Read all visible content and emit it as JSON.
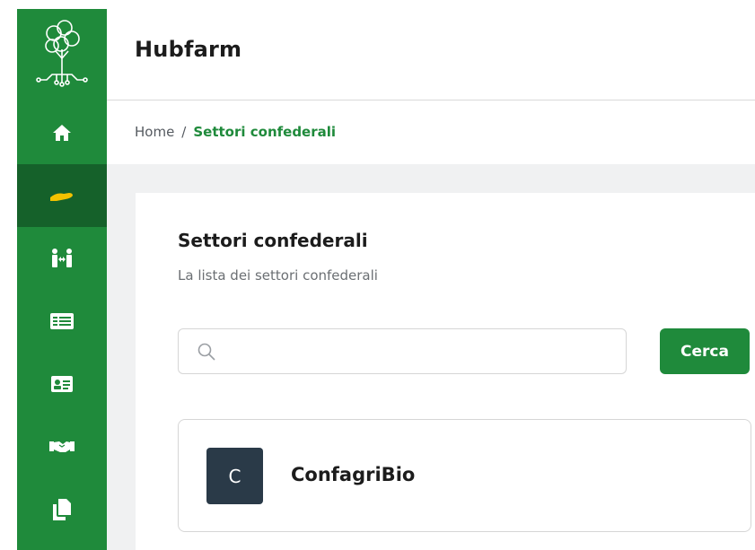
{
  "colors": {
    "brand_green": "#1f8a3b",
    "sidebar_active": "#15612a",
    "active_icon": "#f2c200",
    "avatar_bg": "#2a3a48"
  },
  "header": {
    "title": "Hubfarm"
  },
  "breadcrumb": {
    "home": "Home",
    "separator": "/",
    "current": "Settori confederali"
  },
  "sidebar": {
    "items": [
      {
        "icon": "home-icon"
      },
      {
        "icon": "hand-holding-icon",
        "active": true
      },
      {
        "icon": "people-arrows-icon"
      },
      {
        "icon": "list-card-icon"
      },
      {
        "icon": "id-card-icon"
      },
      {
        "icon": "handshake-icon"
      },
      {
        "icon": "copy-icon"
      }
    ]
  },
  "main": {
    "title": "Settori confederali",
    "subtitle": "La lista dei settori confederali",
    "search": {
      "placeholder": "",
      "value": "",
      "button_label": "Cerca"
    },
    "list": [
      {
        "initial": "C",
        "name": "ConfagriBio"
      }
    ]
  }
}
